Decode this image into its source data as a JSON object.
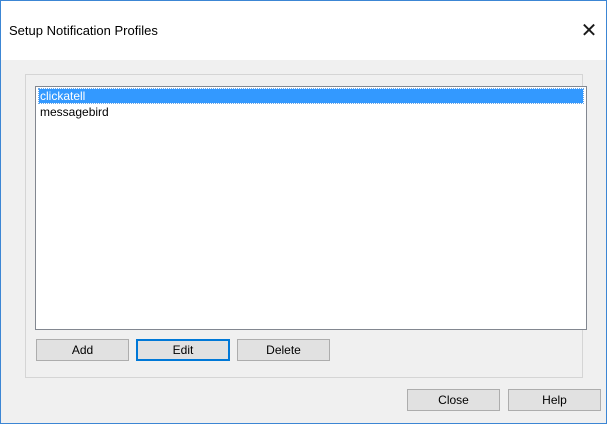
{
  "dialog": {
    "title": "Setup Notification Profiles",
    "close_glyph": "✕"
  },
  "profiles": {
    "items": [
      {
        "label": "clickatell",
        "selected": true
      },
      {
        "label": "messagebird",
        "selected": false
      }
    ]
  },
  "list_buttons": {
    "add_label": "Add",
    "edit_label": "Edit",
    "delete_label": "Delete"
  },
  "footer_buttons": {
    "close_label": "Close",
    "help_label": "Help"
  },
  "colors": {
    "selection": "#3399ff",
    "default_button_border": "#0078d7",
    "window_border": "#3c86d4"
  }
}
